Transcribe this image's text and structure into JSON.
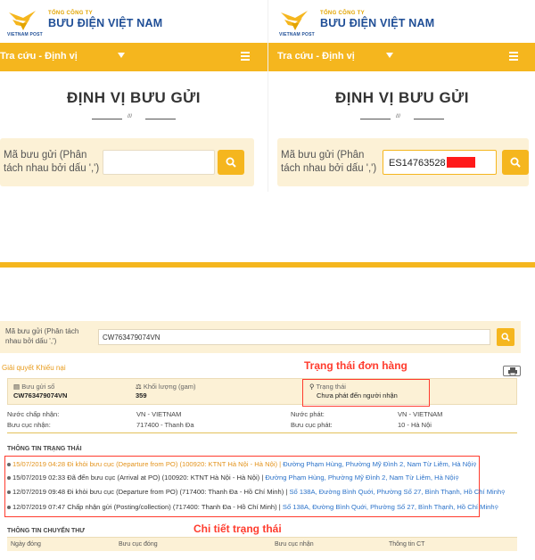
{
  "brand": {
    "logo_sub": "VIETNAM POST",
    "small": "TỔNG CÔNG TY",
    "big": "BƯU ĐIỆN VIỆT NAM"
  },
  "nav": {
    "label": "Tra cứu - Định vị"
  },
  "page": {
    "heading": "ĐỊNH VỊ BƯU GỬI",
    "divider_mark": "///"
  },
  "search": {
    "label_line1": "Mã bưu gửi (Phân",
    "label_line2": "tách nhau bởi dấu ',')",
    "left_value": "",
    "right_value": "ES14763528"
  },
  "tracking": {
    "search_label": "Mã bưu gửi (Phân tách nhau bởi dấu ',')",
    "search_value": "CW763479074VN",
    "complaint_link": "Giải quyết Khiếu nại",
    "annotation_status": "Trạng thái đơn hàng",
    "annotation_detail": "Chi tiết trạng thái",
    "summary": {
      "code_label": "Bưu gửi số",
      "code_value": "CW763479074VN",
      "weight_label": "Khối lượng (gam)",
      "weight_value": "359",
      "status_label": "Trạng thái",
      "status_value": "Chưa phát đến người nhận"
    },
    "details": {
      "accept_country_label": "Nước chấp nhận:",
      "accept_country_value": "VN - VIETNAM",
      "accept_office_label": "Bưu cục nhận:",
      "accept_office_value": "717400 - Thanh Đa",
      "dest_country_label": "Nước phát:",
      "dest_country_value": "VN - VIETNAM",
      "dest_office_label": "Bưu cục phát:",
      "dest_office_value": "10 - Hà Nội"
    },
    "status_section_title": "THÔNG TIN TRẠNG THÁI",
    "events": [
      {
        "time": "15/07/2019 04:28",
        "desc": "Đi khỏi bưu cục (Departure from PO) (100920: KTNT Hà Nội - Hà Nội)",
        "loc": "Đường Phạm Hùng, Phường Mỹ Đình 2, Nam Từ Liêm, Hà Nội"
      },
      {
        "time": "15/07/2019 02:33",
        "desc": "Đã đến bưu cục (Arrival at PO) (100920: KTNT Hà Nội - Hà Nội)",
        "loc": "Đường Phạm Hùng, Phường Mỹ Đình 2, Nam Từ Liêm, Hà Nội"
      },
      {
        "time": "12/07/2019 09:48",
        "desc": "Đi khỏi bưu cục (Departure from PO) (717400: Thanh Đa - Hồ Chí Minh)",
        "loc": "Số 138A, Đường Bình Quới, Phường Số 27, Bình Thạnh, Hồ Chí Minh"
      },
      {
        "time": "12/07/2019 07:47",
        "desc": "Chấp nhận gửi (Posting/collection) (717400: Thanh Đa - Hồ Chí Minh)",
        "loc": "Số 138A, Đường Bình Quới, Phường Số 27, Bình Thạnh, Hồ Chí Minh"
      }
    ],
    "transfer_section_title": "THÔNG TIN CHUYẾN THƯ",
    "transfer_columns": [
      "Ngày đóng",
      "Bưu cục đóng",
      "Bưu cục nhận",
      "Thông tin CT"
    ]
  },
  "colors": {
    "accent": "#f5b61e",
    "brand_blue": "#1f4e96",
    "annotation_red": "#ff3c2e",
    "link_blue": "#2b72c9"
  }
}
